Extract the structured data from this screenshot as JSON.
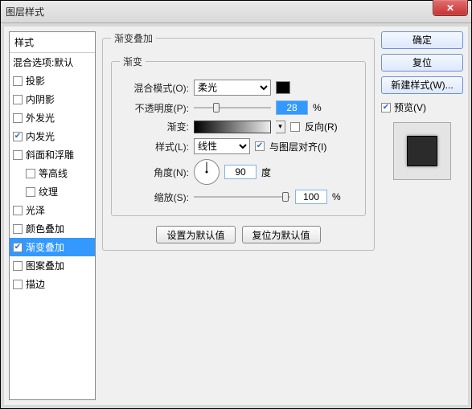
{
  "window": {
    "title": "图层样式"
  },
  "styles": {
    "header": "样式",
    "blendHeader": "混合选项:默认",
    "items": [
      {
        "label": "投影",
        "checked": false
      },
      {
        "label": "内阴影",
        "checked": false
      },
      {
        "label": "外发光",
        "checked": false
      },
      {
        "label": "内发光",
        "checked": true
      },
      {
        "label": "斜面和浮雕",
        "checked": false
      },
      {
        "label": "等高线",
        "checked": false,
        "sub": true
      },
      {
        "label": "纹理",
        "checked": false,
        "sub": true
      },
      {
        "label": "光泽",
        "checked": false
      },
      {
        "label": "颜色叠加",
        "checked": false
      },
      {
        "label": "渐变叠加",
        "checked": true,
        "selected": true
      },
      {
        "label": "图案叠加",
        "checked": false
      },
      {
        "label": "描边",
        "checked": false
      }
    ]
  },
  "panel": {
    "title": "渐变叠加",
    "groupTitle": "渐变",
    "blendMode": {
      "label": "混合模式(O):",
      "value": "柔光"
    },
    "opacity": {
      "label": "不透明度(P):",
      "value": "28",
      "unit": "%"
    },
    "gradient": {
      "label": "渐变:",
      "reverse": "反向(R)",
      "reverseChecked": false
    },
    "style": {
      "label": "样式(L):",
      "value": "线性",
      "align": "与图层对齐(I)",
      "alignChecked": true
    },
    "angle": {
      "label": "角度(N):",
      "value": "90",
      "unit": "度"
    },
    "scale": {
      "label": "缩放(S):",
      "value": "100",
      "unit": "%"
    },
    "buttons": {
      "default": "设置为默认值",
      "reset": "复位为默认值"
    }
  },
  "right": {
    "ok": "确定",
    "cancel": "复位",
    "newStyle": "新建样式(W)...",
    "preview": "预览(V)",
    "previewChecked": true
  }
}
